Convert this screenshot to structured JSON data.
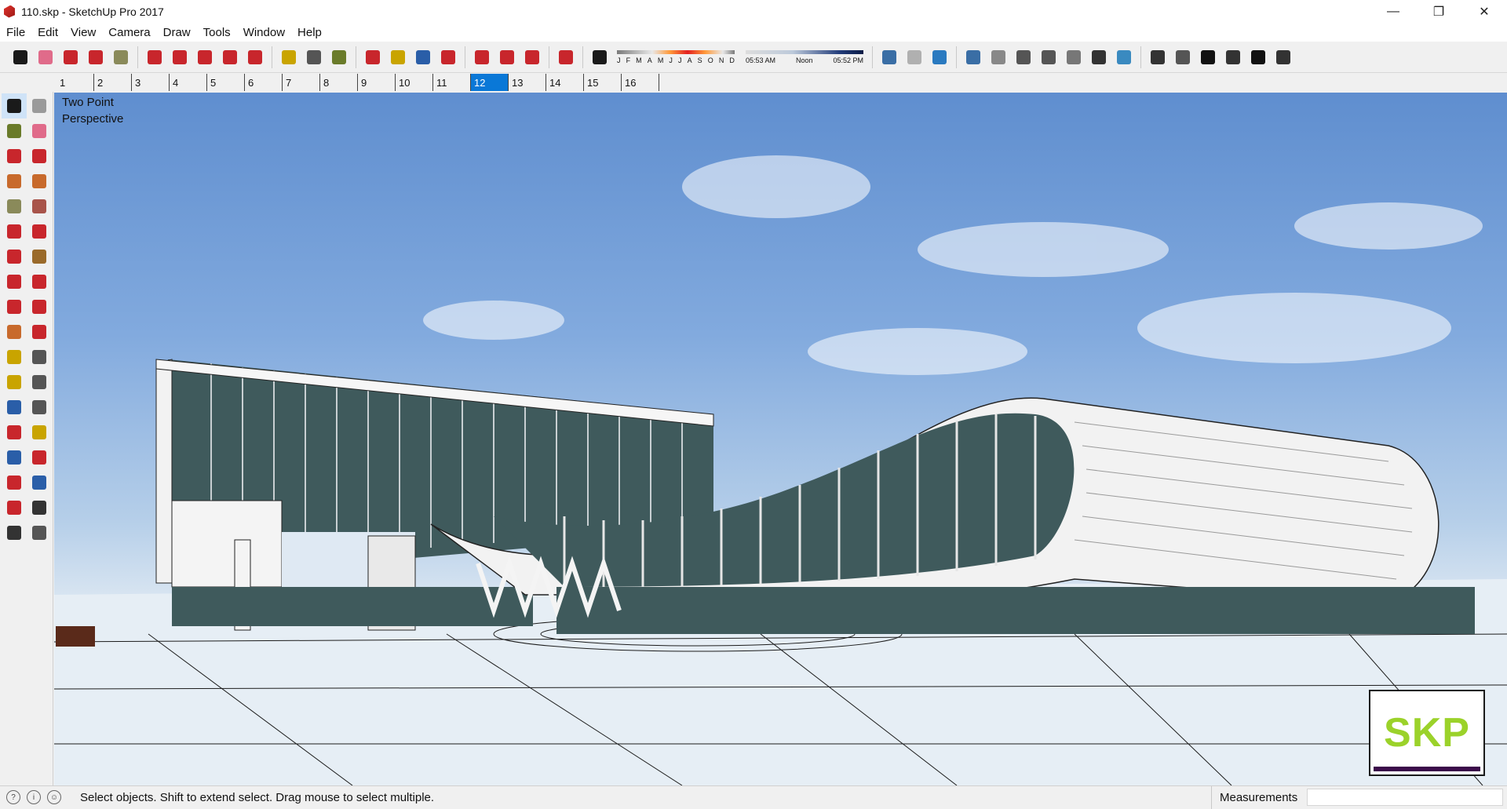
{
  "window": {
    "title": "110.skp - SketchUp Pro 2017",
    "controls": [
      "minimize",
      "restore",
      "close"
    ]
  },
  "menu": [
    "File",
    "Edit",
    "View",
    "Camera",
    "Draw",
    "Tools",
    "Window",
    "Help"
  ],
  "toolbar": {
    "groups": [
      [
        {
          "icon": "select-icon",
          "color": "#1a1a1a"
        },
        {
          "icon": "eraser-icon",
          "color": "#e06b8a"
        },
        {
          "icon": "pencil-icon",
          "color": "#c8262c"
        },
        {
          "icon": "arc-icon",
          "color": "#c8262c"
        },
        {
          "icon": "circle-icon",
          "color": "#8a8a5a"
        }
      ],
      [
        {
          "icon": "pushpull-icon",
          "color": "#c8262c"
        },
        {
          "icon": "followme-icon",
          "color": "#c8262c"
        },
        {
          "icon": "move-icon",
          "color": "#c8262c"
        },
        {
          "icon": "rotate-icon",
          "color": "#c8262c"
        },
        {
          "icon": "scale-icon",
          "color": "#c8262c"
        }
      ],
      [
        {
          "icon": "tape-measure-icon",
          "color": "#c9a400"
        },
        {
          "icon": "text-icon",
          "color": "#555555"
        },
        {
          "icon": "paint-bucket-icon",
          "color": "#6a7b2a"
        }
      ],
      [
        {
          "icon": "orbit-icon",
          "color": "#c8262c"
        },
        {
          "icon": "pan-icon",
          "color": "#c9a400"
        },
        {
          "icon": "zoom-icon",
          "color": "#2a5ea8"
        },
        {
          "icon": "zoom-extents-icon",
          "color": "#c8262c"
        }
      ],
      [
        {
          "icon": "warehouse-icon",
          "color": "#c8262c"
        },
        {
          "icon": "share-model-icon",
          "color": "#c8262c"
        },
        {
          "icon": "extension-warehouse-icon",
          "color": "#c8262c"
        }
      ],
      [
        {
          "icon": "ruby-icon",
          "color": "#c8262c"
        }
      ],
      [
        {
          "icon": "shadows-toggle-icon",
          "color": "#1a1a1a"
        }
      ]
    ],
    "shadow_settings": {
      "months": [
        "J",
        "F",
        "M",
        "A",
        "M",
        "J",
        "J",
        "A",
        "S",
        "O",
        "N",
        "D"
      ],
      "times": [
        "05:53 AM",
        "Noon",
        "05:52 PM"
      ]
    },
    "groups_right": [
      [
        {
          "icon": "add-location-icon",
          "color": "#3a6ea5"
        },
        {
          "icon": "toggle-terrain-icon",
          "color": "#b0b0b0"
        },
        {
          "icon": "photo-textures-icon",
          "color": "#2a7ac0"
        }
      ],
      [
        {
          "icon": "xray-icon",
          "color": "#3a6ea5"
        },
        {
          "icon": "back-edges-icon",
          "color": "#888888"
        },
        {
          "icon": "wireframe-icon",
          "color": "#555555"
        },
        {
          "icon": "hidden-line-icon",
          "color": "#555555"
        },
        {
          "icon": "shaded-icon",
          "color": "#777777"
        },
        {
          "icon": "shaded-textures-icon",
          "color": "#333333"
        },
        {
          "icon": "monochrome-icon",
          "color": "#3a8ac0"
        }
      ],
      [
        {
          "icon": "iso-view-icon",
          "color": "#333333"
        },
        {
          "icon": "top-view-icon",
          "color": "#555555"
        },
        {
          "icon": "front-view-icon",
          "color": "#111111"
        },
        {
          "icon": "right-view-icon",
          "color": "#333333"
        },
        {
          "icon": "back-view-icon",
          "color": "#111111"
        },
        {
          "icon": "left-view-icon",
          "color": "#333333"
        }
      ]
    ]
  },
  "scenes": {
    "tabs": [
      "1",
      "2",
      "3",
      "4",
      "5",
      "6",
      "7",
      "8",
      "9",
      "10",
      "11",
      "12",
      "13",
      "14",
      "15",
      "16"
    ],
    "active": "12"
  },
  "left_tools": [
    {
      "icon": "select-icon",
      "color": "#1a1a1a",
      "active": true
    },
    {
      "icon": "make-component-icon",
      "color": "#9a9a9a"
    },
    {
      "icon": "paint-bucket-icon",
      "color": "#6a7b2a"
    },
    {
      "icon": "eraser-icon",
      "color": "#e06b8a"
    },
    {
      "icon": "line-icon",
      "color": "#c8262c"
    },
    {
      "icon": "freehand-icon",
      "color": "#c8262c"
    },
    {
      "icon": "rectangle-icon",
      "color": "#c86a2c"
    },
    {
      "icon": "rotated-rectangle-icon",
      "color": "#c86a2c"
    },
    {
      "icon": "circle-icon",
      "color": "#8a8a5a"
    },
    {
      "icon": "polygon-icon",
      "color": "#a8544a"
    },
    {
      "icon": "arc-icon",
      "color": "#c8262c"
    },
    {
      "icon": "two-point-arc-icon",
      "color": "#c8262c"
    },
    {
      "icon": "three-point-arc-icon",
      "color": "#c8262c"
    },
    {
      "icon": "pie-icon",
      "color": "#9a6a2a"
    },
    {
      "icon": "move-icon",
      "color": "#c8262c"
    },
    {
      "icon": "pushpull-icon",
      "color": "#c8262c"
    },
    {
      "icon": "rotate-icon",
      "color": "#c8262c"
    },
    {
      "icon": "followme-icon",
      "color": "#c8262c"
    },
    {
      "icon": "scale-icon",
      "color": "#c86a2c"
    },
    {
      "icon": "offset-icon",
      "color": "#c8262c"
    },
    {
      "icon": "tape-measure-icon",
      "color": "#c9a400"
    },
    {
      "icon": "dimension-icon",
      "color": "#555555"
    },
    {
      "icon": "protractor-icon",
      "color": "#c9a400"
    },
    {
      "icon": "text-icon",
      "color": "#555555"
    },
    {
      "icon": "axes-icon",
      "color": "#2a5ea8"
    },
    {
      "icon": "3d-text-icon",
      "color": "#555555"
    },
    {
      "icon": "orbit-icon",
      "color": "#c8262c"
    },
    {
      "icon": "pan-icon",
      "color": "#c9a400"
    },
    {
      "icon": "zoom-icon",
      "color": "#2a5ea8"
    },
    {
      "icon": "zoom-window-icon",
      "color": "#c8262c"
    },
    {
      "icon": "zoom-extents-icon",
      "color": "#c8262c"
    },
    {
      "icon": "previous-view-icon",
      "color": "#2a5ea8"
    },
    {
      "icon": "position-camera-icon",
      "color": "#c8262c"
    },
    {
      "icon": "look-around-icon",
      "color": "#333333"
    },
    {
      "icon": "walk-icon",
      "color": "#333333"
    },
    {
      "icon": "section-plane-icon",
      "color": "#555555"
    }
  ],
  "viewport": {
    "camera_label_line1": "Two Point",
    "camera_label_line2": "Perspective",
    "watermark": "SKP",
    "colors": {
      "sky_top": "#5f8ecf",
      "sky_horizon": "#dfe9f3",
      "glass": "#3f5a5c",
      "white_frame": "#f2f2f2"
    }
  },
  "status": {
    "icons": [
      "geo-location-icon",
      "credits-icon",
      "user-icon"
    ],
    "message": "Select objects. Shift to extend select. Drag mouse to select multiple.",
    "measurements_label": "Measurements",
    "measurements_value": ""
  }
}
